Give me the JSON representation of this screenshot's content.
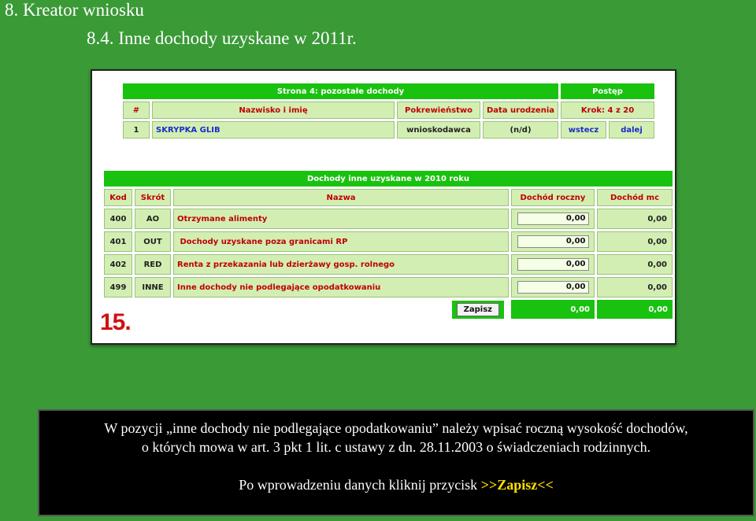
{
  "slide": {
    "title": "8. Kreator wniosku",
    "subtitle": "8.4. Inne dochody uzyskane w  2011r."
  },
  "top_table": {
    "header_main": "Strona 4: pozostałe dochody",
    "header_progress": "Postęp",
    "columns": [
      "#",
      "Nazwisko i imię",
      "Pokrewieństwo",
      "Data urodzenia"
    ],
    "step": "Krok: 4 z 20",
    "row": {
      "num": "1",
      "name": "SKRYPKA GLIB",
      "relation": "wnioskodawca",
      "birth": "(n/d)",
      "back": "wstecz",
      "next": "dalej"
    }
  },
  "income_table": {
    "header": "Dochody inne uzyskane w 2010 roku",
    "columns": [
      "Kod",
      "Skrót",
      "Nazwa",
      "Dochód roczny",
      "Dochód mc"
    ],
    "rows": [
      {
        "code": "400",
        "short": "AO",
        "name": "Otrzymane alimenty",
        "annual": "0,00",
        "monthly": "0,00"
      },
      {
        "code": "401",
        "short": "OUT",
        "name": " Dochody uzyskane poza granicami RP",
        "annual": "0,00",
        "monthly": "0,00"
      },
      {
        "code": "402",
        "short": "RED",
        "name": "Renta z przekazania lub dzierżawy gosp. rolnego",
        "annual": "0,00",
        "monthly": "0,00"
      },
      {
        "code": "499",
        "short": "INNE",
        "name": "Inne dochody nie podlegające opodatkowaniu",
        "annual": "0,00",
        "monthly": "0,00"
      }
    ],
    "save_label": "Zapisz",
    "total_annual": "0,00",
    "total_monthly": "0,00"
  },
  "step_number": "15.",
  "note": {
    "line1": "W pozycji „inne dochody nie podlegające opodatkowaniu” należy wpisać roczną wysokość dochodów,",
    "line2": "o których mowa w art. 3 pkt 1 lit. c ustawy z dn. 28.11.2003 o świadczeniach rodzinnych.",
    "line3_prefix": "Po wprowadzeniu danych kliknij przycisk ",
    "line3_highlight": ">>Zapisz<<"
  }
}
